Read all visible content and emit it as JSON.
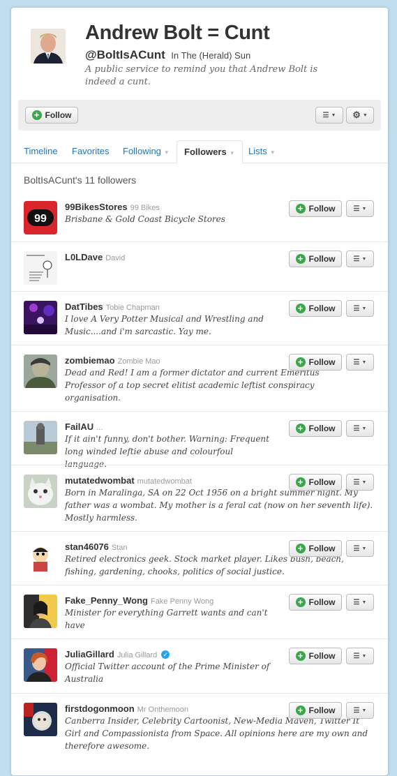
{
  "profile": {
    "name": "Andrew Bolt = Cunt",
    "handle": "@BoltIsACunt",
    "location": "In The (Herald) Sun",
    "bio": "A public service to remind you that Andrew Bolt is indeed a cunt."
  },
  "actions": {
    "follow_label": "Follow"
  },
  "tabs": [
    {
      "label": "Timeline"
    },
    {
      "label": "Favorites"
    },
    {
      "label": "Following"
    },
    {
      "label": "Followers"
    },
    {
      "label": "Lists"
    }
  ],
  "followers_title": "BoltIsACunt's 11 followers",
  "follow_label": "Follow",
  "followers": [
    {
      "username": "99BikesStores",
      "name": "99 Bikes",
      "bio": "Brisbane & Gold Coast Bicycle Stores"
    },
    {
      "username": "L0LDave",
      "name": "David",
      "bio": ""
    },
    {
      "username": "DatTibes",
      "name": "Tobie Chapman",
      "bio": "I love A Very Potter Musical and Wrestling and Music....and i'm sarcastic. Yay me."
    },
    {
      "username": "zombiemao",
      "name": "Zombie Mao",
      "bio": "Dead and Red! I am a former dictator and current Emeritus Professor of a top secret elitist academic leftist conspiracy organisation."
    },
    {
      "username": "FailAU",
      "name": "...",
      "bio": "If it ain't funny, don't bother. Warning: Frequent long winded leftie abuse and colourfoul language."
    },
    {
      "username": "mutatedwombat",
      "name": "mutatedwombat",
      "bio": "Born in Maralinga, SA on 22 Oct 1956 on a bright summer night. My father was a wombat. My mother is a feral cat (now on her seventh life). Mostly harmless."
    },
    {
      "username": "stan46076",
      "name": "Stan",
      "bio": "Retired electronics geek. Stock market player. Likes bush, beach, fishing, gardening, chooks, politics of social justice."
    },
    {
      "username": "Fake_Penny_Wong",
      "name": "Fake Penny Wong",
      "bio": "Minister for everything Garrett wants and can't have"
    },
    {
      "username": "JuliaGillard",
      "name": "Julia Gillard",
      "bio": "Official Twitter account of the Prime Minister of Australia"
    },
    {
      "username": "firstdogonmoon",
      "name": "Mr Onthemoon",
      "bio": "Canberra Insider, Celebrity Cartoonist, New-Media Maven, Twitter It Girl and Compassionista from Space. All opinions here are my own and therefore awesome."
    }
  ],
  "avatar_badge_99": "99"
}
